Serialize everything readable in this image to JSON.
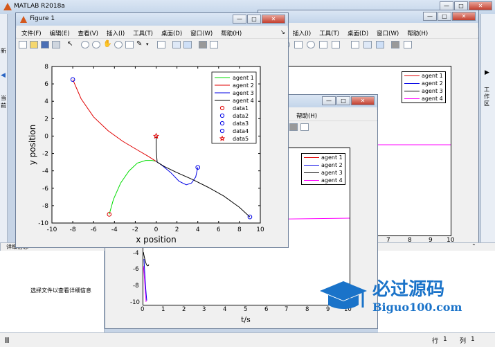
{
  "app": {
    "title": "MATLAB R2018a",
    "side_tab": "工作区",
    "left_tab": "当前",
    "left_new": "新"
  },
  "bg_figure": {
    "menu": [
      "插入(I)",
      "工具(T)",
      "桌面(D)",
      "窗口(W)",
      "帮助(H)"
    ],
    "legend": [
      "agent 1",
      "agent 2",
      "agent 3",
      "agent 4"
    ],
    "xticks": [
      "7",
      "8",
      "9",
      "10"
    ]
  },
  "detail_panel": {
    "title": "详细信息",
    "empty_text": "选择文件以查看详细信息"
  },
  "status_bar": {
    "row_label": "行",
    "row_value": "1",
    "col_label": "列",
    "col_value": "1"
  },
  "mid_figure": {
    "menu": [
      "帮助(H)"
    ],
    "legend": [
      "agent 1",
      "agent 2",
      "agent 3",
      "agent 4"
    ],
    "xticks": [
      "0",
      "1",
      "2",
      "3",
      "4",
      "5",
      "6",
      "7",
      "8",
      "9",
      "10"
    ],
    "yticks": [
      "-4",
      "-6",
      "-8",
      "-10"
    ],
    "xlabel": "t/s"
  },
  "figure1": {
    "title": "Figure 1",
    "menu": [
      "文件(F)",
      "编辑(E)",
      "查看(V)",
      "插入(I)",
      "工具(T)",
      "桌面(D)",
      "窗口(W)",
      "帮助(H)"
    ]
  },
  "watermark": {
    "cn": "必过源码",
    "en": "Biguo100.com"
  },
  "colors": {
    "agent1": "#00dd00",
    "agent2": "#e00000",
    "agent3": "#0000e6",
    "agent4": "#000000",
    "agent4_t": "#ff00ff"
  },
  "chart_data": [
    {
      "type": "line",
      "xlabel": "x position",
      "ylabel": "y position",
      "xlim": [
        -10,
        10
      ],
      "ylim": [
        -10,
        8
      ],
      "xticks": [
        -10,
        -8,
        -6,
        -4,
        -2,
        0,
        2,
        4,
        6,
        8,
        10
      ],
      "yticks": [
        -10,
        -8,
        -6,
        -4,
        -2,
        0,
        2,
        4,
        6,
        8
      ],
      "grid": false,
      "legend_position": "top-right",
      "series": [
        {
          "name": "agent 1",
          "color": "#00dd00",
          "x": [
            -4.5,
            -4.1,
            -3.4,
            -2.6,
            -1.8,
            -1.0,
            -0.4,
            0.0
          ],
          "y": [
            -9.0,
            -7.3,
            -5.4,
            -4.0,
            -3.1,
            -2.8,
            -2.8,
            -2.9
          ]
        },
        {
          "name": "agent 2",
          "color": "#e00000",
          "x": [
            -8.0,
            -7.2,
            -6.0,
            -4.6,
            -3.2,
            -1.8,
            -0.8,
            0.0
          ],
          "y": [
            6.5,
            4.3,
            2.2,
            0.6,
            -0.6,
            -1.6,
            -2.3,
            -2.9
          ]
        },
        {
          "name": "agent 3",
          "color": "#0000e6",
          "x": [
            4.0,
            3.8,
            3.4,
            2.9,
            2.2,
            1.4,
            0.6,
            0.0
          ],
          "y": [
            -3.6,
            -4.7,
            -5.4,
            -5.6,
            -5.2,
            -4.2,
            -3.4,
            -2.9
          ]
        },
        {
          "name": "agent 4",
          "color": "#000000",
          "x": [
            9.0,
            8.0,
            6.5,
            5.0,
            3.5,
            2.0,
            0.8,
            0.1,
            0.0,
            0.0
          ],
          "y": [
            -9.3,
            -8.2,
            -6.9,
            -5.9,
            -5.0,
            -4.2,
            -3.5,
            -3.0,
            -1.5,
            0.0
          ]
        }
      ],
      "markers": [
        {
          "name": "data1",
          "color": "#e00000",
          "shape": "circle",
          "x": -4.5,
          "y": -9.0
        },
        {
          "name": "data2",
          "color": "#0000e6",
          "shape": "circle",
          "x": -8.0,
          "y": 6.5
        },
        {
          "name": "data3",
          "color": "#0000e6",
          "shape": "circle",
          "x": 4.0,
          "y": -3.6
        },
        {
          "name": "data4",
          "color": "#0000e6",
          "shape": "circle",
          "x": 9.0,
          "y": -9.3
        },
        {
          "name": "data5",
          "color": "#e00000",
          "shape": "star",
          "x": 0.0,
          "y": 0.0
        }
      ]
    }
  ]
}
